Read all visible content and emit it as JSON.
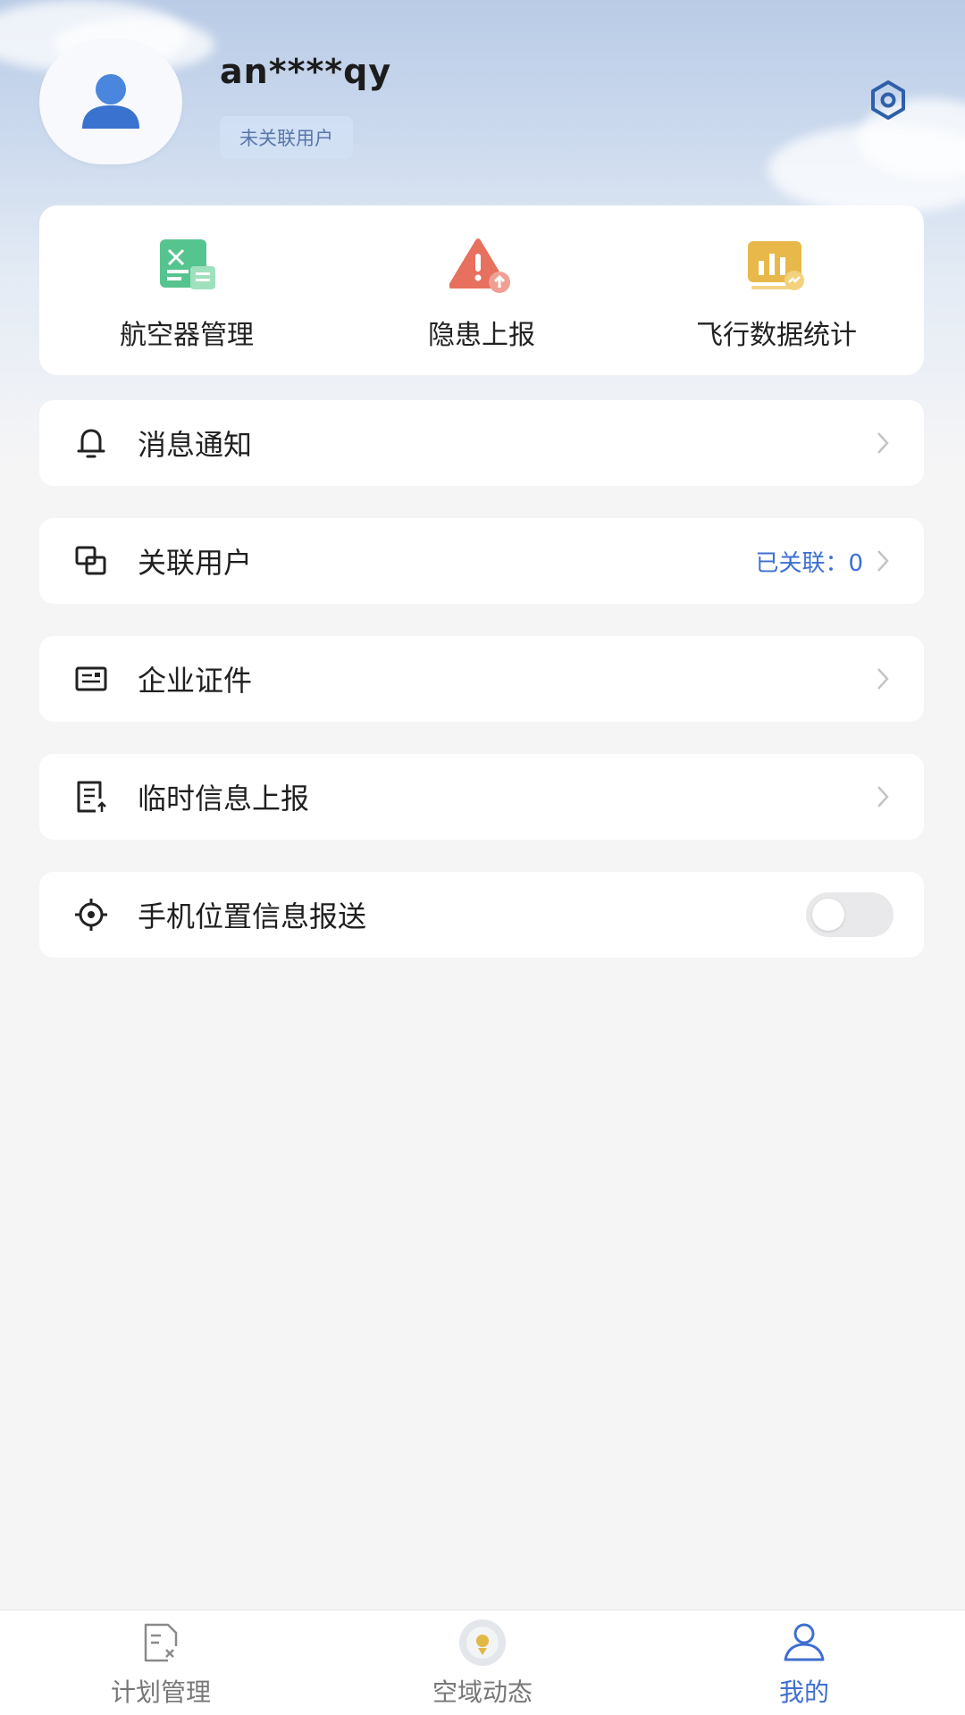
{
  "user": {
    "name": "an****qy",
    "tag": "未关联用户"
  },
  "quick_actions": [
    {
      "label": "航空器管理",
      "icon": "aircraft-management-icon",
      "color": "#4fbf86"
    },
    {
      "label": "隐患上报",
      "icon": "hazard-report-icon",
      "color": "#e06a5b"
    },
    {
      "label": "飞行数据统计",
      "icon": "flight-statistics-icon",
      "color": "#e2b53b"
    }
  ],
  "menu": {
    "notifications": {
      "label": "消息通知",
      "icon": "bell-icon"
    },
    "linked_users": {
      "label": "关联用户",
      "extra": "已关联：0",
      "icon": "link-users-icon"
    },
    "enterprise_cert": {
      "label": "企业证件",
      "icon": "id-card-icon"
    },
    "temp_report": {
      "label": "临时信息上报",
      "icon": "document-upload-icon"
    },
    "location_report": {
      "label": "手机位置信息报送",
      "icon": "location-target-icon",
      "enabled": false
    }
  },
  "tabs": [
    {
      "label": "计划管理",
      "icon": "plan-document-icon",
      "active": false
    },
    {
      "label": "空域动态",
      "icon": "airspace-icon",
      "active": false
    },
    {
      "label": "我的",
      "icon": "profile-icon",
      "active": true
    }
  ],
  "colors": {
    "accent": "#3f6fd0",
    "page_background": "#f5f5f6"
  }
}
